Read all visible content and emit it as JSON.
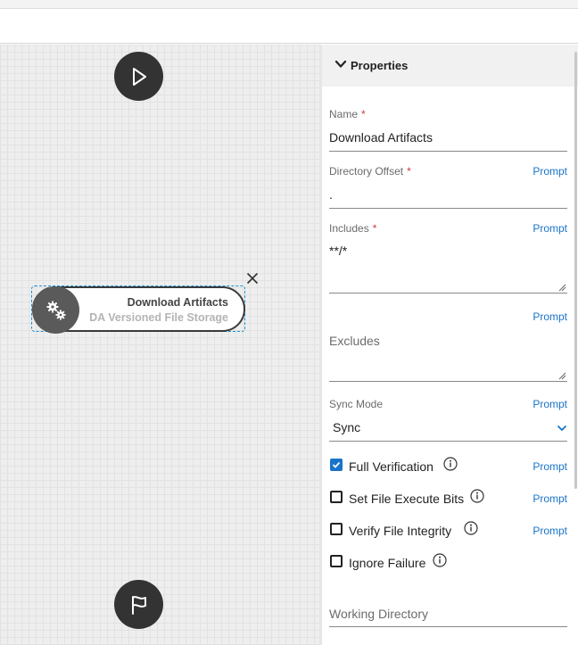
{
  "properties": {
    "header": "Properties",
    "fields": {
      "name": {
        "label": "Name",
        "required_mark": "*",
        "value": "Download Artifacts"
      },
      "directory_offset": {
        "label": "Directory Offset",
        "required_mark": "*",
        "value": ".",
        "prompt": "Prompt"
      },
      "includes": {
        "label": "Includes",
        "required_mark": "*",
        "value": "**/*",
        "prompt": "Prompt"
      },
      "excludes": {
        "label": "Excludes",
        "value": "",
        "prompt": "Prompt"
      },
      "sync_mode": {
        "label": "Sync Mode",
        "value": "Sync",
        "prompt": "Prompt"
      },
      "working_directory": {
        "label": "Working Directory"
      }
    },
    "checkboxes": [
      {
        "label": "Full Verification",
        "checked": true,
        "prompt": "Prompt"
      },
      {
        "label": "Set File Execute Bits",
        "checked": false,
        "prompt": "Prompt"
      },
      {
        "label": "Verify File Integrity",
        "checked": false,
        "prompt": "Prompt"
      },
      {
        "label": "Ignore Failure",
        "checked": false
      }
    ]
  },
  "canvas": {
    "step": {
      "title": "Download Artifacts",
      "subtitle": "DA Versioned File Storage"
    },
    "icons": [
      "play-icon",
      "gears-icon",
      "close-icon",
      "flag-icon",
      "info-icon",
      "chevron-down-icon"
    ]
  },
  "colors": {
    "accent": "#1a73c8",
    "required": "#d0393e",
    "node_dark": "#333333",
    "selection": "#1a8fd6"
  }
}
